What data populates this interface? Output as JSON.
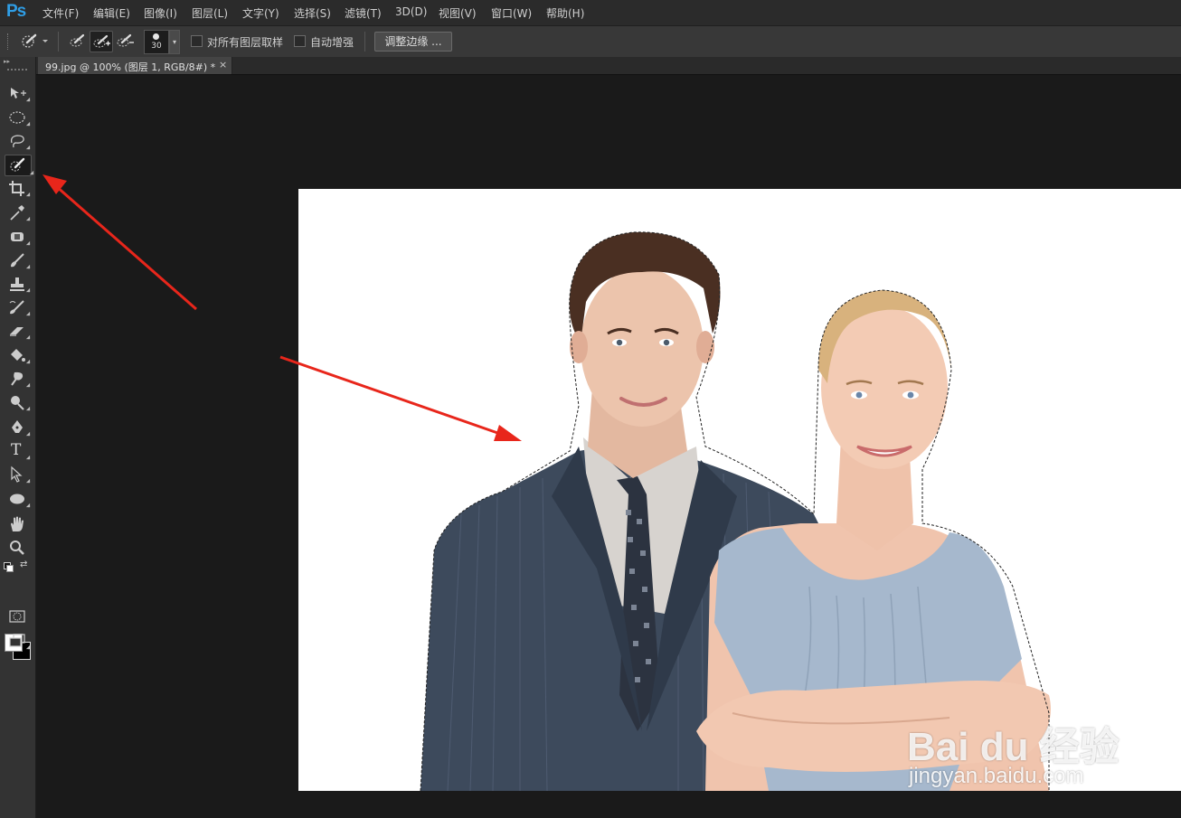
{
  "app": {
    "logo": "Ps"
  },
  "menu": [
    {
      "label": "文件(F)"
    },
    {
      "label": "编辑(E)"
    },
    {
      "label": "图像(I)"
    },
    {
      "label": "图层(L)"
    },
    {
      "label": "文字(Y)"
    },
    {
      "label": "选择(S)"
    },
    {
      "label": "滤镜(T)"
    },
    {
      "label": "3D(D)"
    },
    {
      "label": "视图(V)"
    },
    {
      "label": "窗口(W)"
    },
    {
      "label": "帮助(H)"
    }
  ],
  "options": {
    "brush_size": "30",
    "sample_all_layers": "对所有图层取样",
    "auto_enhance": "自动增强",
    "refine_edge": "调整边缘 ..."
  },
  "document": {
    "tab_label": "99.jpg @ 100% (图层 1, RGB/8#) *",
    "close_glyph": "×"
  },
  "toolbar": {
    "type_tool_glyph": "T"
  },
  "watermark": {
    "brand": "Bai du 经验",
    "url": "jingyan.baidu.com"
  },
  "colors": {
    "foreground": "#ffffff",
    "background": "#000000",
    "annotation_arrow": "#e8261b",
    "ps_blue": "#2f9ee6"
  }
}
